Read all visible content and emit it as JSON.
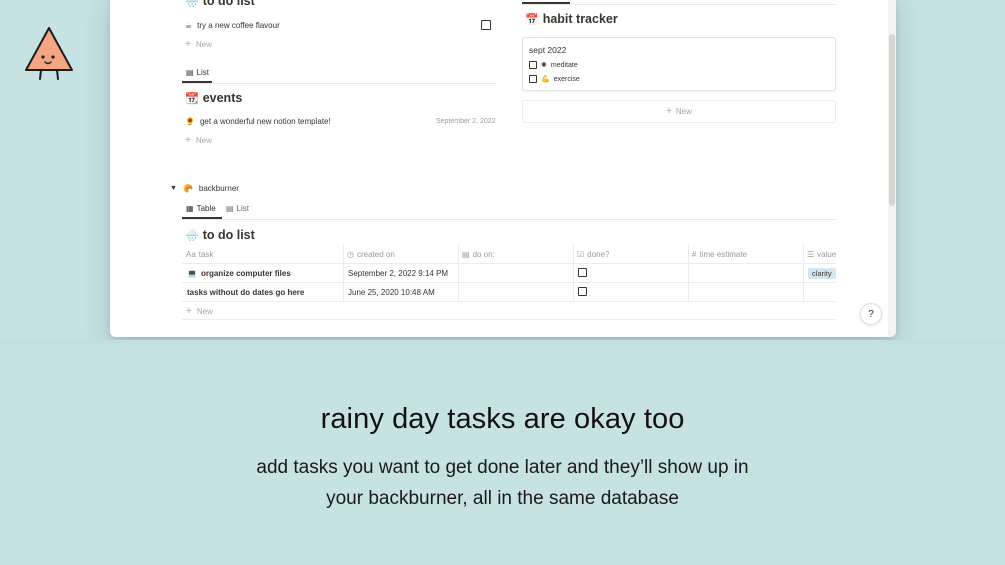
{
  "colors": {
    "background": "#c6e2e3",
    "tag": "#d3e5ef",
    "mascot": "#f4a582"
  },
  "todo_top": {
    "title": "to do list",
    "icon": "umbrella-cloud-icon",
    "item": "try a new coffee flavour",
    "item_icon": "coffee-icon",
    "new_label": "New"
  },
  "events": {
    "tab_label": "List",
    "title": "events",
    "icon": "calendar-icon",
    "item": "get a wonderful new notion template!",
    "item_icon": "sunflower-icon",
    "item_date": "September 2, 2022",
    "new_label": "New"
  },
  "habit_tracker": {
    "title": "habit tracker",
    "icon": "calendar-check-icon",
    "card_title": "sept 2022",
    "items": [
      {
        "label": "meditate",
        "icon": "sparkle-icon"
      },
      {
        "label": "exercise",
        "icon": "flexed-arm-icon"
      }
    ],
    "new_label": "New"
  },
  "backburner": {
    "toggle_label": "backburner",
    "toggle_icon": "croissant-icon",
    "tabs": [
      {
        "label": "Table",
        "icon": "table-icon"
      },
      {
        "label": "List",
        "icon": "list-icon"
      }
    ],
    "table_title": "to do list",
    "table_icon": "umbrella-cloud-icon",
    "columns": [
      {
        "label": "task",
        "icon": "Aa"
      },
      {
        "label": "created on",
        "icon": "◷"
      },
      {
        "label": "do on:",
        "icon": "▤"
      },
      {
        "label": "done?",
        "icon": "☑"
      },
      {
        "label": "time estimate",
        "icon": "#"
      },
      {
        "label": "value",
        "icon": "☰"
      }
    ],
    "rows": [
      {
        "task": "organize computer files",
        "task_icon": "laptop-icon",
        "created": "September 2, 2022 9:14 PM",
        "do_on": "",
        "done": false,
        "time": "",
        "value": "clarity"
      },
      {
        "task": "tasks without do dates go here",
        "task_icon": "",
        "created": "June 25, 2020 10:48 AM",
        "do_on": "",
        "done": false,
        "time": "",
        "value": ""
      }
    ],
    "new_label": "New"
  },
  "help_label": "?",
  "caption": {
    "title": "rainy day tasks are okay too",
    "line1": "add tasks you want to get done later and they’ll show up in",
    "line2": "your backburner, all in the same database"
  }
}
